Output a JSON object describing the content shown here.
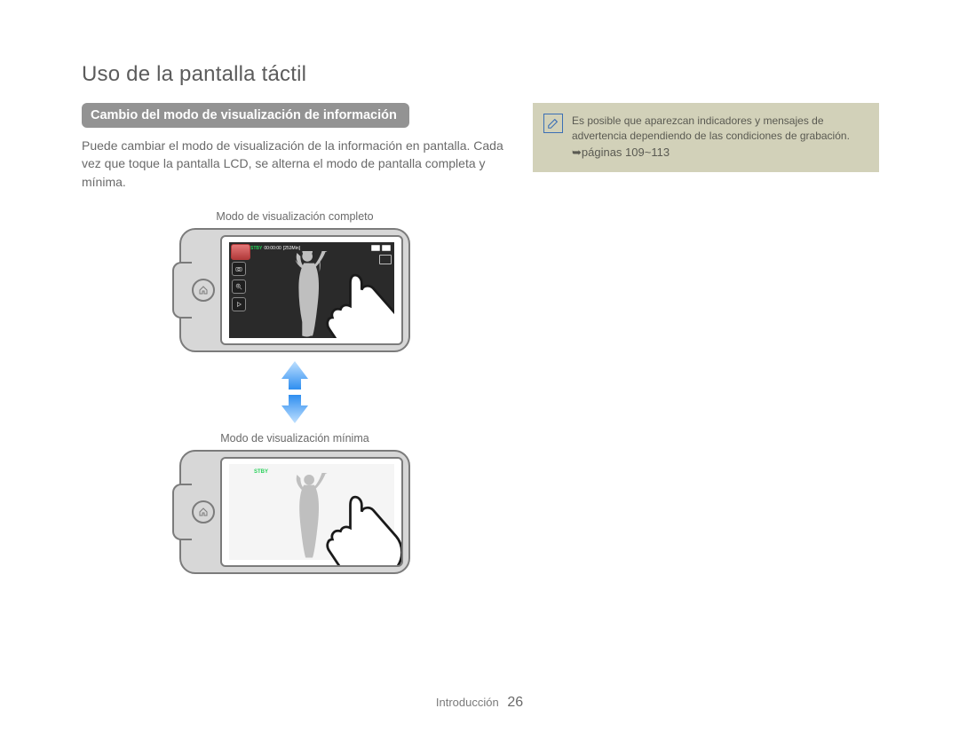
{
  "page": {
    "title": "Uso de la pantalla táctil",
    "section_label": "Introducción",
    "page_number": "26"
  },
  "section": {
    "heading": "Cambio del modo de visualización de información",
    "body": "Puede cambiar el modo de visualización de la información en pantalla. Cada vez que toque la pantalla LCD, se alterna el modo de pantalla completa y mínima."
  },
  "diagrams": {
    "full": {
      "caption": "Modo de visualización completo",
      "stby": "STBY",
      "time": "00:00:00",
      "remaining": "[253Min]"
    },
    "minimal": {
      "caption": "Modo de visualización mínima",
      "stby": "STBY"
    }
  },
  "note": {
    "text": "Es posible que aparezcan indicadores y mensajes de advertencia dependiendo de las condiciones de grabación. ",
    "ref": "➥páginas 109~113"
  },
  "icons": {
    "note_icon": "pencil-note-icon",
    "home_icon": "home-icon",
    "camera_icon": "camera-icon",
    "zoom_icon": "zoom-in-icon",
    "play_icon": "play-icon",
    "battery_icon": "battery-icon",
    "card_icon": "sd-card-icon",
    "smart_icon": "smart-auto-icon",
    "hd_icon": "hd-badge-icon"
  }
}
